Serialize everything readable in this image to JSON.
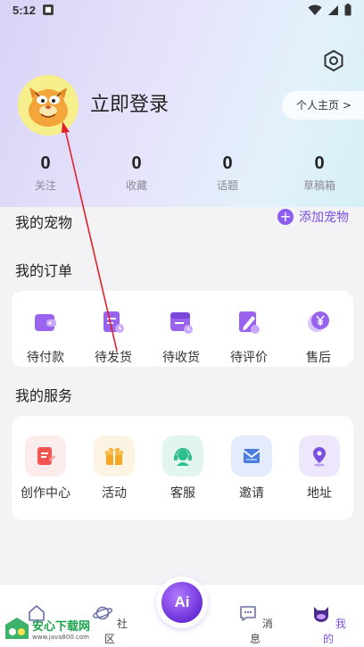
{
  "status_bar": {
    "time": "5:12"
  },
  "header": {
    "login_text": "立即登录",
    "profile_button": "个人主页 >",
    "stats": [
      {
        "value": "0",
        "label": "关注"
      },
      {
        "value": "0",
        "label": "收藏"
      },
      {
        "value": "0",
        "label": "话题"
      },
      {
        "value": "0",
        "label": "草稿箱"
      }
    ]
  },
  "pets": {
    "title": "我的宠物",
    "add_label": "添加宠物"
  },
  "orders": {
    "title": "我的订单",
    "items": [
      {
        "label": "待付款",
        "icon": "wallet-icon"
      },
      {
        "label": "待发货",
        "icon": "shipping-doc-icon"
      },
      {
        "label": "待收货",
        "icon": "receive-box-icon"
      },
      {
        "label": "待评价",
        "icon": "review-pen-icon"
      },
      {
        "label": "售后",
        "icon": "yen-aftersale-icon"
      }
    ]
  },
  "services": {
    "title": "我的服务",
    "items": [
      {
        "label": "创作中心",
        "icon": "create-doc-icon",
        "color": "#f0554f"
      },
      {
        "label": "活动",
        "icon": "gift-icon",
        "color": "#f5a623"
      },
      {
        "label": "客服",
        "icon": "headset-icon",
        "color": "#2fbf8f"
      },
      {
        "label": "邀请",
        "icon": "mail-icon",
        "color": "#4a7fe0"
      },
      {
        "label": "地址",
        "icon": "location-pin-icon",
        "color": "#7b4fe0"
      }
    ]
  },
  "nav": {
    "items": [
      {
        "label": "首页",
        "icon": "home-icon"
      },
      {
        "label": "社区",
        "icon": "planet-icon"
      },
      {
        "label": "Ai",
        "icon": "ai-icon"
      },
      {
        "label": "消息",
        "icon": "chat-icon"
      },
      {
        "label": "我的",
        "icon": "cat-face-icon"
      }
    ],
    "active_color": "#7b4fe0"
  },
  "watermark": {
    "title": "安心下载网",
    "url": "www.java800.com"
  }
}
